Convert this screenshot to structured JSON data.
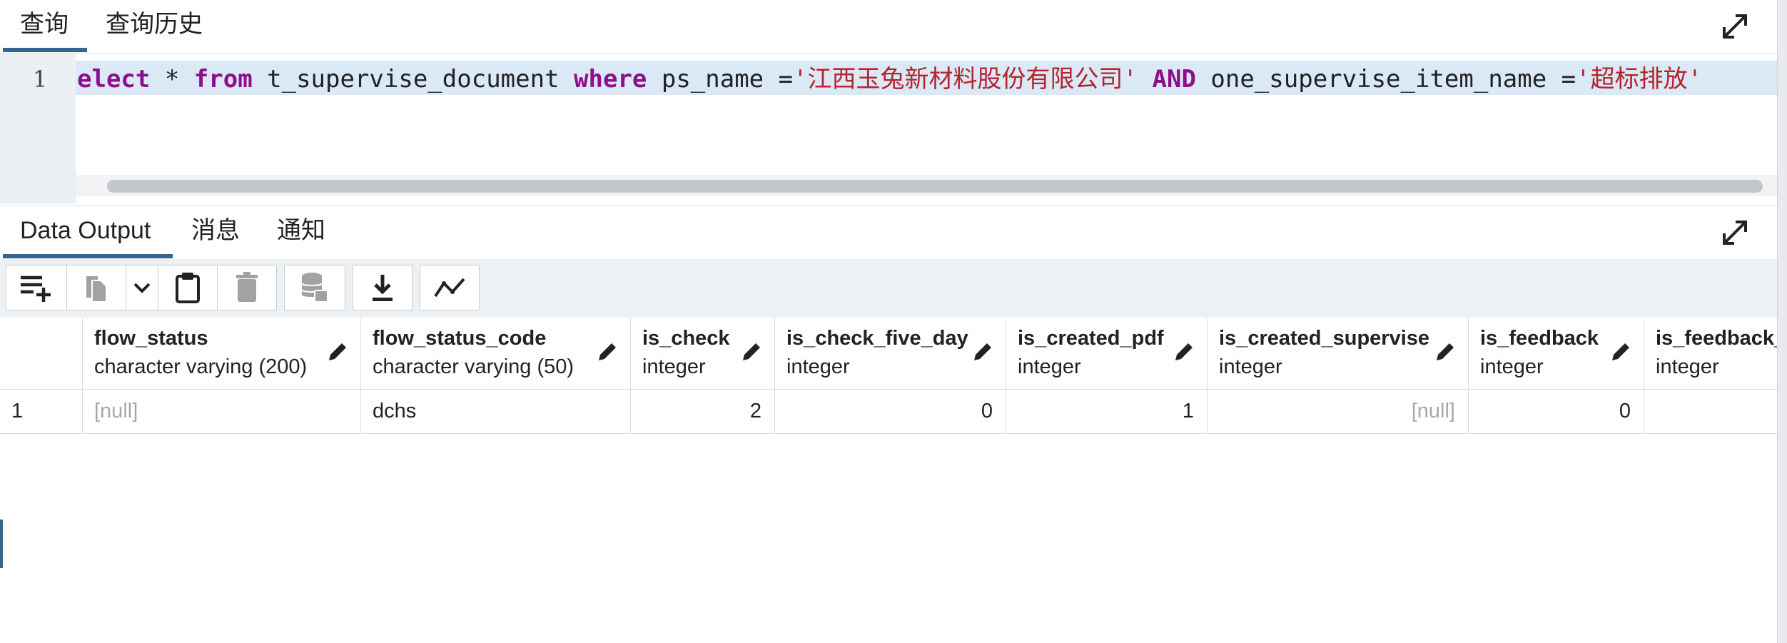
{
  "query_tabs": [
    {
      "label": "查询",
      "active": true
    },
    {
      "label": "查询历史",
      "active": false
    }
  ],
  "editor": {
    "line_number": "1",
    "tokens": [
      {
        "text": "elect",
        "kind": "kw"
      },
      {
        "text": " * ",
        "kind": "plain"
      },
      {
        "text": "from",
        "kind": "kw"
      },
      {
        "text": " t_supervise_document ",
        "kind": "plain"
      },
      {
        "text": "where",
        "kind": "kw"
      },
      {
        "text": " ps_name =",
        "kind": "plain"
      },
      {
        "text": "'江西玉兔新材料股份有限公司'",
        "kind": "str"
      },
      {
        "text": " ",
        "kind": "plain"
      },
      {
        "text": "AND",
        "kind": "kw"
      },
      {
        "text": " one_supervise_item_name =",
        "kind": "plain"
      },
      {
        "text": "'超标排放'",
        "kind": "str"
      }
    ]
  },
  "output_tabs": [
    {
      "label": "Data Output",
      "active": true
    },
    {
      "label": "消息",
      "active": false
    },
    {
      "label": "通知",
      "active": false
    }
  ],
  "toolbar_icons": [
    "add-row-icon",
    "copy-icon",
    "chevron-down-icon",
    "paste-icon",
    "delete-icon",
    "save-data-icon",
    "download-icon",
    "graph-icon"
  ],
  "grid": {
    "columns": [
      {
        "name": "flow_status",
        "type": "character varying (200)"
      },
      {
        "name": "flow_status_code",
        "type": "character varying (50)"
      },
      {
        "name": "is_check",
        "type": "integer"
      },
      {
        "name": "is_check_five_day",
        "type": "integer"
      },
      {
        "name": "is_created_pdf",
        "type": "integer"
      },
      {
        "name": "is_created_supervise",
        "type": "integer"
      },
      {
        "name": "is_feedback",
        "type": "integer"
      },
      {
        "name": "is_feedback_",
        "type": "integer"
      }
    ],
    "rows": [
      {
        "row_number": "1",
        "cells": [
          "[null]",
          "dchs",
          "2",
          "0",
          "1",
          "[null]",
          "0",
          ""
        ]
      }
    ]
  },
  "colors": {
    "accent": "#326690",
    "keyword": "#8e0e8c",
    "string": "#b5232b",
    "highlight": "#dbe9f7"
  }
}
